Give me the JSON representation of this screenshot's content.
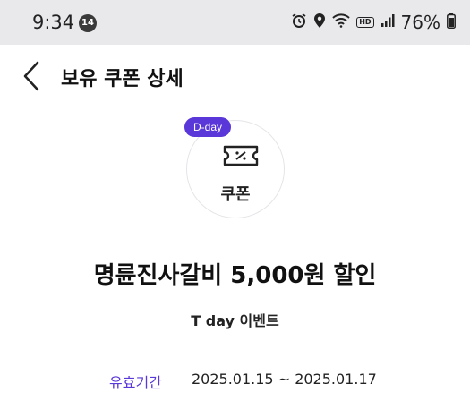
{
  "status_bar": {
    "time": "9:34",
    "notification_count": "14",
    "hd": "HD",
    "battery": "76%"
  },
  "header": {
    "title": "보유 쿠폰 상세"
  },
  "coupon": {
    "badge": "D-day",
    "type_label": "쿠폰",
    "title": "명륜진사갈비 5,000원 할인",
    "subtitle": "T day 이벤트",
    "validity_label": "유효기간",
    "validity_value": "2025.01.15 ~ 2025.01.17"
  },
  "colors": {
    "accent": "#5a37d8",
    "status_bar_bg": "#e9e9ec"
  },
  "icons": [
    "alarm-icon",
    "location-icon",
    "wifi-icon",
    "signal-icon",
    "battery-icon",
    "back-arrow-icon",
    "coupon-ticket-icon"
  ]
}
